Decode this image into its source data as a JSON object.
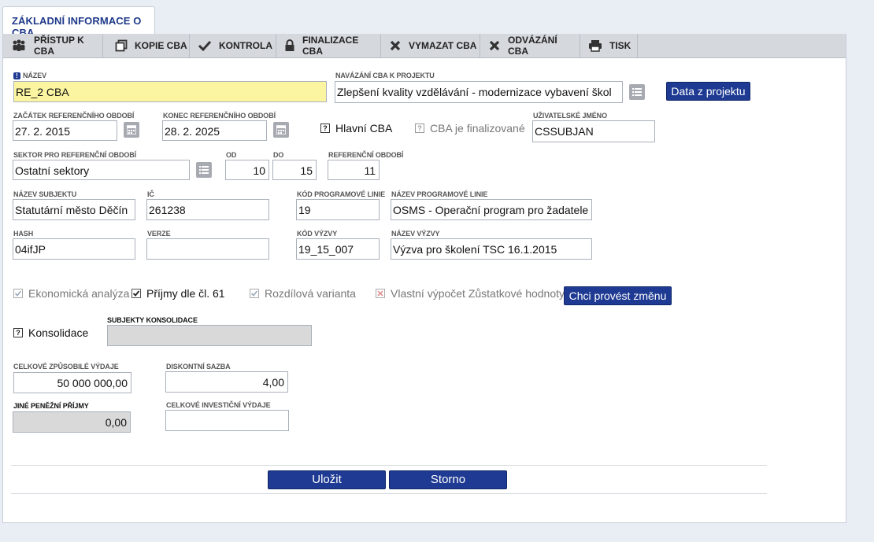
{
  "page_tab": "ZÁKLADNÍ INFORMACE O CBA",
  "toolbar": {
    "access": "PŘÍSTUP K CBA",
    "copy": "KOPIE CBA",
    "check": "KONTROLA",
    "finalize": "FINALIZACE CBA",
    "delete": "VYMAZAT CBA",
    "unlink": "ODVÁZÁNÍ CBA",
    "print": "TISK"
  },
  "form": {
    "name": {
      "label": "NÁZEV",
      "value": "RE_2 CBA"
    },
    "project_link": {
      "label": "NAVÁZÁNÍ CBA K PROJEKTU",
      "value": "Zlepšení kvality vzdělávání - modernizace vybavení škol"
    },
    "data_from_project": "Data z projektu",
    "ref_start": {
      "label": "ZAČÁTEK REFERENČNÍHO OBDOBÍ",
      "value": "27. 2. 2015"
    },
    "ref_end": {
      "label": "KONEC REFERENČNÍHO OBDOBÍ",
      "value": "28. 2. 2025"
    },
    "main_cba": "Hlavní CBA",
    "cba_finalized": "CBA je finalizované",
    "username": {
      "label": "UŽIVATELSKÉ JMÉNO",
      "value": "CSSUBJAN"
    },
    "sector": {
      "label": "SEKTOR PRO REFERENČNÍ OBDOBÍ",
      "value": "Ostatní sektory"
    },
    "from": {
      "label": "OD",
      "value": "10"
    },
    "to": {
      "label": "DO",
      "value": "15"
    },
    "ref_period": {
      "label": "REFERENČNÍ OBDOBÍ",
      "value": "11"
    },
    "subject_name": {
      "label": "NÁZEV SUBJEKTU",
      "value": "Statutární město Děčín"
    },
    "ic": {
      "label": "IČ",
      "value": "261238"
    },
    "program_code": {
      "label": "KÓD PROGRAMOVÉ LINIE",
      "value": "19"
    },
    "program_name": {
      "label": "NÁZEV PROGRAMOVÉ LINIE",
      "value": "OSMS - Operační program pro žadatele"
    },
    "hash": {
      "label": "HASH",
      "value": "04ifJP"
    },
    "version": {
      "label": "VERZE",
      "value": ""
    },
    "call_code": {
      "label": "KÓD VÝZVY",
      "value": "19_15_007"
    },
    "call_name": {
      "label": "NÁZEV VÝZVY",
      "value": "Výzva pro školení TSC 16.1.2015"
    },
    "economic_analysis": "Ekonomická analýza",
    "income_art61": "Příjmy dle čl. 61",
    "differential_variant": "Rozdílová varianta",
    "own_residual": "Vlastní výpočet Zůstatkové hodnoty",
    "change_button": "Chci provést změnu",
    "consolidation": "Konsolidace",
    "consolidation_subjects": {
      "label": "SUBJEKTY KONSOLIDACE",
      "value": ""
    },
    "eligible_expenses": {
      "label": "CELKOVÉ ZPŮSOBILÉ VÝDAJE",
      "value": "50 000 000,00"
    },
    "discount_rate": {
      "label": "DISKONTNÍ SAZBA",
      "value": "4,00"
    },
    "other_income": {
      "label": "JINÉ PENĚŽNÍ PŘÍJMY",
      "value": "0,00"
    },
    "investment_expenses": {
      "label": "CELKOVÉ INVESTIČNÍ VÝDAJE",
      "value": ""
    }
  },
  "actions": {
    "save": "Uložit",
    "cancel": "Storno"
  },
  "colors": {
    "accent": "#1e3a92",
    "required_bg": "#fbf5a2",
    "toolbar_bg": "#d5d8dd"
  }
}
